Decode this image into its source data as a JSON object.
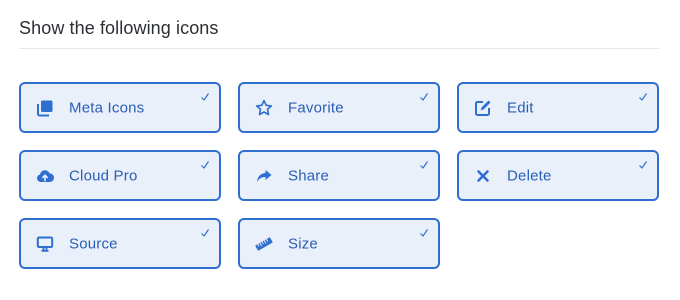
{
  "section": {
    "heading": "Show the following icons"
  },
  "colors": {
    "accent": "#2f6fd0",
    "tile_background": "#eaf0fa",
    "label": "#2a5eb5"
  },
  "options": [
    {
      "label": "Meta Icons",
      "icon": "stacked-windows-icon",
      "checked": true
    },
    {
      "label": "Favorite",
      "icon": "star-icon",
      "checked": true
    },
    {
      "label": "Edit",
      "icon": "edit-icon",
      "checked": true
    },
    {
      "label": "Cloud Pro",
      "icon": "cloud-upload-icon",
      "checked": true
    },
    {
      "label": "Share",
      "icon": "share-icon",
      "checked": true
    },
    {
      "label": "Delete",
      "icon": "close-icon",
      "checked": true
    },
    {
      "label": "Source",
      "icon": "monitor-icon",
      "checked": true
    },
    {
      "label": "Size",
      "icon": "ruler-icon",
      "checked": true
    }
  ]
}
